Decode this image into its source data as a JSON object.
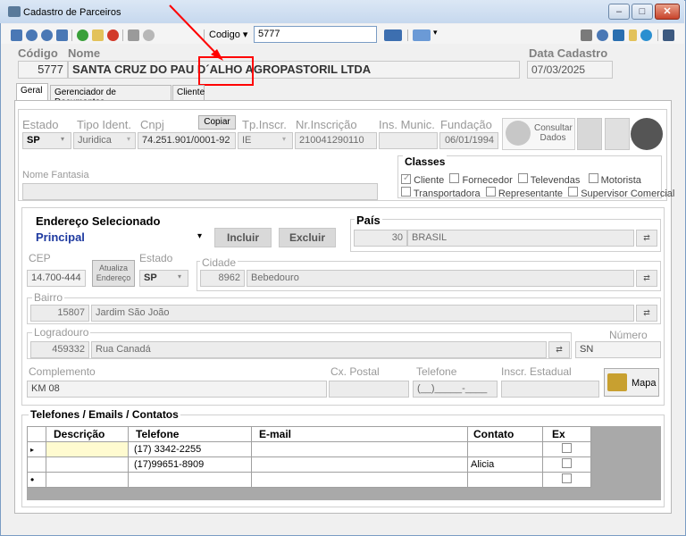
{
  "window": {
    "title": "Cadastro de Parceiros",
    "btn_min": "–",
    "btn_max": "□",
    "btn_close": "✕"
  },
  "toolbar": {
    "codigo_label": "Codigo ▾",
    "codigo_value": "5777"
  },
  "header": {
    "codigo_label": "Código",
    "nome_label": "Nome",
    "data_label": "Data Cadastro",
    "codigo_value": "5777",
    "nome_value": "SANTA CRUZ DO PAU D´ALHO AGROPASTORIL LTDA",
    "data_value": "07/03/2025"
  },
  "tabs": [
    "Geral",
    "Gerenciador de Documentos",
    "Cliente"
  ],
  "geral": {
    "estado_label": "Estado",
    "estado_value": "SP",
    "tipo_label": "Tipo Ident.",
    "tipo_value": "Juridica",
    "cnpj_label": "Cnpj",
    "cnpj_value": "74.251.901/0001-92",
    "copiar_label": "Copiar",
    "tpinscr_label": "Tp.Inscr.",
    "tpinscr_value": "IE",
    "nrinscr_label": "Nr.Inscrição",
    "nrinscr_value": "210041290110",
    "insmunic_label": "Ins. Munic.",
    "insmunic_value": "",
    "fundacao_label": "Fundação",
    "fundacao_value": "06/01/1994",
    "consultar_label": "Consultar Dados",
    "nome_fantasia_label": "Nome Fantasia",
    "nome_fantasia_value": ""
  },
  "classes": {
    "title": "Classes",
    "items": [
      {
        "label": "Cliente",
        "checked": true
      },
      {
        "label": "Fornecedor",
        "checked": false
      },
      {
        "label": "Televendas",
        "checked": false
      },
      {
        "label": "Motorista",
        "checked": false
      },
      {
        "label": "Transportadora",
        "checked": false
      },
      {
        "label": "Representante",
        "checked": false
      },
      {
        "label": "Supervisor Comercial",
        "checked": false
      }
    ]
  },
  "endereco": {
    "title": "Endereço Selecionado",
    "selected": "Principal",
    "incluir_label": "Incluir",
    "excluir_label": "Excluir",
    "pais_label": "País",
    "pais_code": "30",
    "pais_name": "BRASIL",
    "cep_label": "CEP",
    "cep_value": "14.700-444",
    "atualiza_label": "Atualiza Endereço",
    "estado_label": "Estado",
    "estado_value": "SP",
    "cidade_label": "Cidade",
    "cidade_code": "8962",
    "cidade_name": "Bebedouro",
    "bairro_label": "Bairro",
    "bairro_code": "15807",
    "bairro_name": "Jardim São João",
    "logradouro_label": "Logradouro",
    "logradouro_code": "459332",
    "logradouro_name": "Rua Canadá",
    "numero_label": "Número",
    "numero_value": "SN",
    "complemento_label": "Complemento",
    "complemento_value": "KM 08",
    "cxpostal_label": "Cx. Postal",
    "cxpostal_value": "",
    "telefone_label": "Telefone",
    "telefone_value": "(__)_____-____",
    "inscr_label": "Inscr. Estadual",
    "inscr_value": "",
    "mapa_label": "Mapa"
  },
  "contatos": {
    "title": "Telefones / Emails / Contatos",
    "columns": [
      "Descrição",
      "Telefone",
      "E-mail",
      "Contato",
      "Ex"
    ],
    "rows": [
      {
        "marker": "▸",
        "descricao": "",
        "telefone": "(17) 3342-2255",
        "email": "",
        "contato": ""
      },
      {
        "marker": "",
        "descricao": "",
        "telefone": "(17)99651-8909",
        "email": "",
        "contato": "Alicia"
      },
      {
        "marker": "•",
        "descricao": "",
        "telefone": "",
        "email": "",
        "contato": ""
      }
    ]
  }
}
